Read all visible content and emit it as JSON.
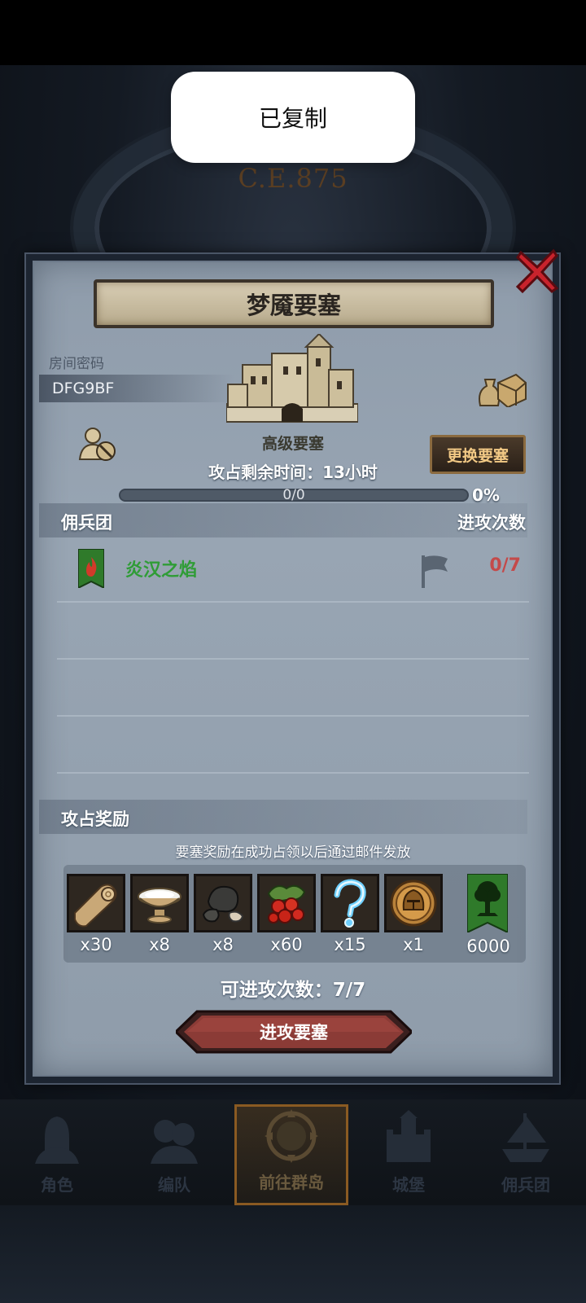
{
  "toast": {
    "text": "已复制"
  },
  "background": {
    "year_text": "C.E.875"
  },
  "dialog": {
    "title": "梦魇要塞",
    "room_code_label": "房间密码",
    "room_code": "DFG9BF",
    "fortress_type": "高级要塞",
    "change_button": "更换要塞",
    "time_remaining": "攻占剩余时间：13小时",
    "progress": {
      "text": "0/0",
      "percent_label": "0%",
      "value": 0
    },
    "guilds_section": {
      "left_header": "佣兵团",
      "right_header": "进攻次数"
    },
    "guilds": [
      {
        "name": "炎汉之焰",
        "attacks": "0/7"
      }
    ],
    "rewards_section": {
      "header": "攻占奖励",
      "note": "要塞奖励在成功占领以后通过邮件发放",
      "items": [
        {
          "icon": "wood-log-icon",
          "qty": "x30"
        },
        {
          "icon": "white-bowl-icon",
          "qty": "x8"
        },
        {
          "icon": "black-ore-icon",
          "qty": "x8"
        },
        {
          "icon": "red-berries-icon",
          "qty": "x60"
        },
        {
          "icon": "blue-question-icon",
          "qty": "x15"
        },
        {
          "icon": "knight-helmet-coin-icon",
          "qty": "x1"
        },
        {
          "icon": "green-tree-banner-icon",
          "qty": "6000"
        }
      ]
    },
    "available_attacks": "可进攻次数：7/7",
    "attack_button": "进攻要塞"
  },
  "bottom_nav": [
    {
      "label": "角色",
      "icon": "knight-icon",
      "active": false
    },
    {
      "label": "编队",
      "icon": "squad-icon",
      "active": false
    },
    {
      "label": "前往群岛",
      "icon": "compass-globe-icon",
      "active": true
    },
    {
      "label": "城堡",
      "icon": "castle-icon",
      "active": false
    },
    {
      "label": "佣兵团",
      "icon": "ship-icon",
      "active": false
    }
  ],
  "colors": {
    "guild_name": "#2f9c36",
    "attacks_count": "#c44a4a",
    "change_button_text": "#f2c985"
  }
}
